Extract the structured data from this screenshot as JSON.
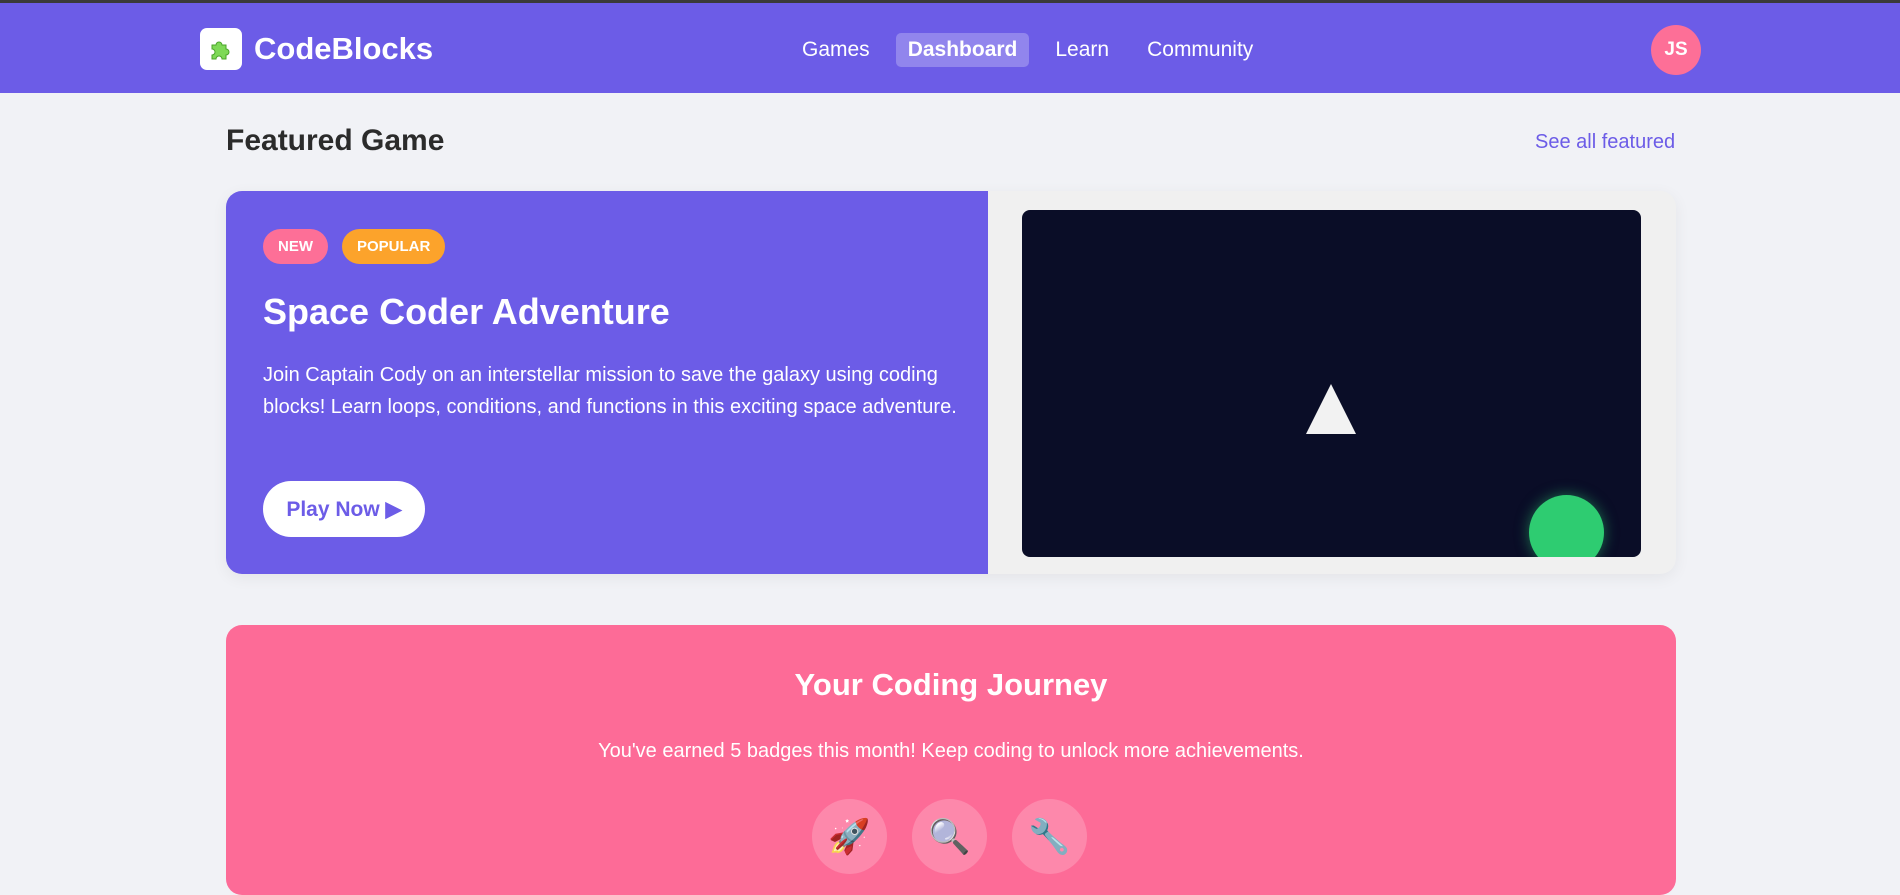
{
  "header": {
    "logo_icon": "puzzle-icon",
    "logo_text": "CodeBlocks",
    "nav": [
      {
        "label": "Games",
        "active": false
      },
      {
        "label": "Dashboard",
        "active": true
      },
      {
        "label": "Learn",
        "active": false
      },
      {
        "label": "Community",
        "active": false
      }
    ],
    "avatar_initials": "JS"
  },
  "featured": {
    "section_title": "Featured Game",
    "see_all": "See all featured",
    "badges": [
      "NEW",
      "POPULAR"
    ],
    "title": "Space Coder Adventure",
    "description": "Join Captain Cody on an interstellar mission to save the galaxy using coding blocks! Learn loops, conditions, and functions in this exciting space adventure.",
    "play_label": "Play Now ▶"
  },
  "journey": {
    "title": "Your Coding Journey",
    "subtitle": "You've earned 5 badges this month! Keep coding to unlock more achievements.",
    "achievements": [
      {
        "icon": "rocket-icon",
        "glyph": "🚀"
      },
      {
        "icon": "magnifier-icon",
        "glyph": "🔍"
      },
      {
        "icon": "wrench-icon",
        "glyph": "🔧"
      }
    ]
  },
  "colors": {
    "brand": "#6c5ce7",
    "pink": "#fd6b97",
    "orange": "#fca32b",
    "screen": "#0a0d27",
    "planet": "#2ecc71"
  }
}
